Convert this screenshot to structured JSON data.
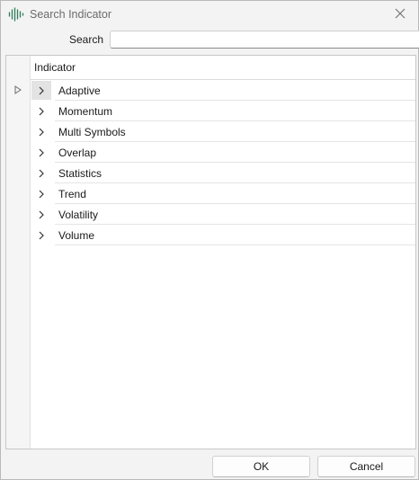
{
  "window": {
    "title": "Search Indicator",
    "close_icon": "close-icon",
    "app_icon": "waveform-icon"
  },
  "search": {
    "label": "Search",
    "value": "",
    "placeholder": ""
  },
  "grid": {
    "column_header": "Indicator",
    "rows": [
      {
        "label": "Adaptive",
        "icon": "chevron-right-icon"
      },
      {
        "label": "Momentum",
        "icon": "chevron-right-icon"
      },
      {
        "label": "Multi Symbols",
        "icon": "chevron-right-icon"
      },
      {
        "label": "Overlap",
        "icon": "chevron-right-icon"
      },
      {
        "label": "Statistics",
        "icon": "chevron-right-icon"
      },
      {
        "label": "Trend",
        "icon": "chevron-right-icon"
      },
      {
        "label": "Volatility",
        "icon": "chevron-right-icon"
      },
      {
        "label": "Volume",
        "icon": "chevron-right-icon"
      }
    ],
    "current_row_indicator": "triangle-right-icon"
  },
  "buttons": {
    "ok": "OK",
    "cancel": "Cancel"
  },
  "colors": {
    "app_icon": "#2e7d5b",
    "background": "#f3f3f3"
  }
}
